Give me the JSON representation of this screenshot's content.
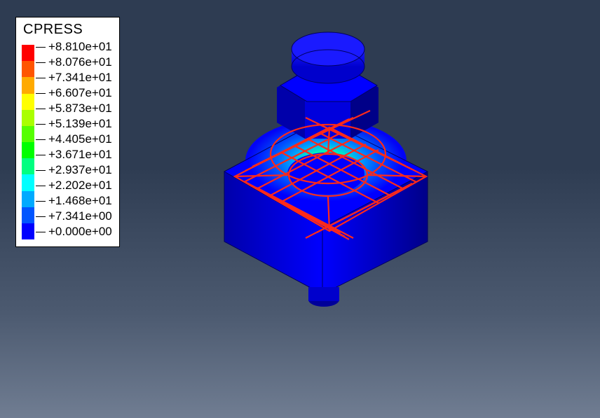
{
  "legend": {
    "title": "CPRESS",
    "values": [
      "+8.810e+01",
      "+8.076e+01",
      "+7.341e+01",
      "+6.607e+01",
      "+5.873e+01",
      "+5.139e+01",
      "+4.405e+01",
      "+3.671e+01",
      "+2.937e+01",
      "+2.202e+01",
      "+1.468e+01",
      "+7.341e+00",
      "+0.000e+00"
    ],
    "colors": [
      "#ff0000",
      "#ff5500",
      "#ffaa00",
      "#ffff00",
      "#aaff00",
      "#55ff00",
      "#00ff00",
      "#00ff80",
      "#00ffff",
      "#00aaff",
      "#0055ff",
      "#0000ff"
    ]
  },
  "model": {
    "description": "Bolt head and hex nut on a square block with contact-pressure contour and red reference mesh surface",
    "mesh_color": "#ff2a1a",
    "base_color": "#0000ff",
    "contour_visible": true
  }
}
